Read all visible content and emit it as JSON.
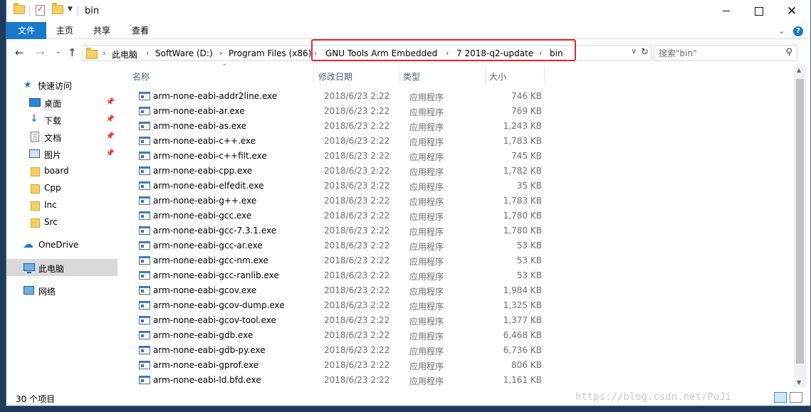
{
  "window": {
    "title": "bin"
  },
  "ribbon": {
    "tabs": [
      "文件",
      "主页",
      "共享",
      "查看"
    ]
  },
  "address": {
    "crumbs": [
      "此电脑",
      "SoftWare (D:)",
      "Program Files (x86)",
      "GNU Tools Arm Embedded",
      "7 2018-q2-update",
      "bin"
    ],
    "separator": "›"
  },
  "search": {
    "placeholder": "搜索\"bin\""
  },
  "nav_pane": {
    "quick_access": "快速访问",
    "pinned": [
      "桌面",
      "下载",
      "文档",
      "图片"
    ],
    "folders": [
      "board",
      "Cpp",
      "Inc",
      "Src"
    ],
    "onedrive": "OneDrive",
    "this_pc": "此电脑",
    "network": "网络"
  },
  "columns": {
    "name": "名称",
    "date": "修改日期",
    "type": "类型",
    "size": "大小"
  },
  "files": [
    {
      "name": "arm-none-eabi-addr2line.exe",
      "date": "2018/6/23 2:22",
      "type": "应用程序",
      "size": "746 KB"
    },
    {
      "name": "arm-none-eabi-ar.exe",
      "date": "2018/6/23 2:22",
      "type": "应用程序",
      "size": "769 KB"
    },
    {
      "name": "arm-none-eabi-as.exe",
      "date": "2018/6/23 2:22",
      "type": "应用程序",
      "size": "1,243 KB"
    },
    {
      "name": "arm-none-eabi-c++.exe",
      "date": "2018/6/23 2:22",
      "type": "应用程序",
      "size": "1,783 KB"
    },
    {
      "name": "arm-none-eabi-c++filt.exe",
      "date": "2018/6/23 2:22",
      "type": "应用程序",
      "size": "745 KB"
    },
    {
      "name": "arm-none-eabi-cpp.exe",
      "date": "2018/6/23 2:22",
      "type": "应用程序",
      "size": "1,782 KB"
    },
    {
      "name": "arm-none-eabi-elfedit.exe",
      "date": "2018/6/23 2:22",
      "type": "应用程序",
      "size": "35 KB"
    },
    {
      "name": "arm-none-eabi-g++.exe",
      "date": "2018/6/23 2:22",
      "type": "应用程序",
      "size": "1,783 KB"
    },
    {
      "name": "arm-none-eabi-gcc.exe",
      "date": "2018/6/23 2:22",
      "type": "应用程序",
      "size": "1,780 KB"
    },
    {
      "name": "arm-none-eabi-gcc-7.3.1.exe",
      "date": "2018/6/23 2:22",
      "type": "应用程序",
      "size": "1,780 KB"
    },
    {
      "name": "arm-none-eabi-gcc-ar.exe",
      "date": "2018/6/23 2:22",
      "type": "应用程序",
      "size": "53 KB"
    },
    {
      "name": "arm-none-eabi-gcc-nm.exe",
      "date": "2018/6/23 2:22",
      "type": "应用程序",
      "size": "53 KB"
    },
    {
      "name": "arm-none-eabi-gcc-ranlib.exe",
      "date": "2018/6/23 2:22",
      "type": "应用程序",
      "size": "53 KB"
    },
    {
      "name": "arm-none-eabi-gcov.exe",
      "date": "2018/6/23 2:22",
      "type": "应用程序",
      "size": "1,984 KB"
    },
    {
      "name": "arm-none-eabi-gcov-dump.exe",
      "date": "2018/6/23 2:22",
      "type": "应用程序",
      "size": "1,325 KB"
    },
    {
      "name": "arm-none-eabi-gcov-tool.exe",
      "date": "2018/6/23 2:22",
      "type": "应用程序",
      "size": "1,377 KB"
    },
    {
      "name": "arm-none-eabi-gdb.exe",
      "date": "2018/6/23 2:22",
      "type": "应用程序",
      "size": "6,468 KB"
    },
    {
      "name": "arm-none-eabi-gdb-py.exe",
      "date": "2018/6/23 2:22",
      "type": "应用程序",
      "size": "6,736 KB"
    },
    {
      "name": "arm-none-eabi-gprof.exe",
      "date": "2018/6/23 2:22",
      "type": "应用程序",
      "size": "806 KB"
    },
    {
      "name": "arm-none-eabi-ld.bfd.exe",
      "date": "2018/6/23 2:22",
      "type": "应用程序",
      "size": "1,161 KB"
    }
  ],
  "status": {
    "item_count": "30 个项目"
  },
  "watermark": "https://blog.csdn.net/PoJi",
  "colors": {
    "accent": "#1979ca",
    "highlight_box": "#e8262b",
    "selected_nav": "#d9d9d9"
  }
}
